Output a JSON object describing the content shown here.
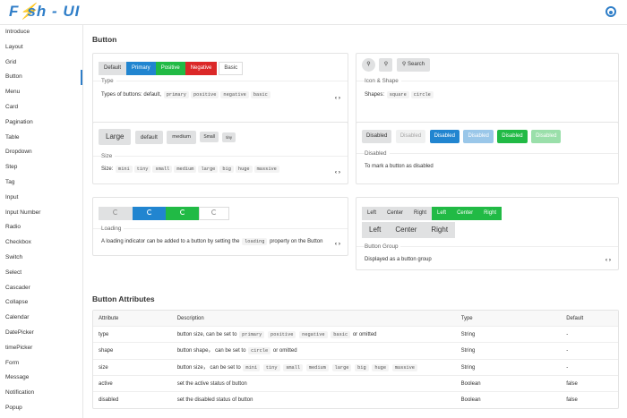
{
  "header": {
    "logo_left": "F",
    "logo_right": "sh - UI",
    "github_icon": "github-icon"
  },
  "sidebar": {
    "items": [
      "Introduce",
      "Layout",
      "Grid",
      "Button",
      "Menu",
      "Card",
      "Pagination",
      "Table",
      "Dropdown",
      "Step",
      "Tag",
      "Input",
      "Input Number",
      "Radio",
      "Checkbox",
      "Switch",
      "Select",
      "Cascader",
      "Collapse",
      "Calendar",
      "DatePicker",
      "timePicker",
      "Form",
      "Message",
      "Notification",
      "Popup"
    ],
    "active": "Button"
  },
  "page": {
    "title": "Button",
    "attr_title": "Button Attributes"
  },
  "cards": {
    "type": {
      "buttons": [
        "Default",
        "Primary",
        "Positive",
        "Negative",
        "Basic"
      ],
      "title": "Type",
      "desc_text": "Types of buttons: default,",
      "codes": [
        "primary",
        "positive",
        "negative",
        "basic"
      ]
    },
    "icon": {
      "buttons": [
        "Search"
      ],
      "title": "Icon & Shape",
      "desc_text": "Shapes:",
      "codes": [
        "square",
        "circle"
      ]
    },
    "size": {
      "buttons": [
        "Large",
        "default",
        "medium",
        "Small",
        "tiny"
      ],
      "title": "Size",
      "desc_text": "Size:",
      "codes": [
        "mini",
        "tiny",
        "small",
        "medium",
        "large",
        "big",
        "huge",
        "massive"
      ]
    },
    "disabled": {
      "buttons": [
        "Disabled",
        "Disabled",
        "Disabled",
        "Disabled",
        "Disabled",
        "Disabled"
      ],
      "title": "Disabled",
      "desc": "To mark a button as disabled"
    },
    "loading": {
      "title": "Loading",
      "desc_before": "A loading indicator can be added to a button by setting the",
      "code": "loading",
      "desc_after": "property on the Button"
    },
    "group": {
      "row1": [
        "Left",
        "Center",
        "Right",
        "Left",
        "Center",
        "Right"
      ],
      "row2": [
        "Left",
        "Center",
        "Right"
      ],
      "title": "Button Group",
      "desc": "Displayed as a button group"
    },
    "code_toggle": "‹ ›"
  },
  "table": {
    "headers": [
      "Attribute",
      "Description",
      "Type",
      "Default"
    ],
    "rows": [
      {
        "attr": "type",
        "desc_before": "button size, can be set to",
        "codes": [
          "primary",
          "positive",
          "negative",
          "basic"
        ],
        "desc_after": "or omitted",
        "type": "String",
        "default": "-"
      },
      {
        "attr": "shape",
        "desc_before": "button shape， can be set to",
        "codes": [
          "circle"
        ],
        "desc_after": "or omitted",
        "type": "String",
        "default": "-"
      },
      {
        "attr": "size",
        "desc_before": "button size， can be set to",
        "codes": [
          "mini",
          "tiny",
          "small",
          "medium",
          "large",
          "big",
          "huge",
          "massive"
        ],
        "desc_after": "",
        "type": "String",
        "default": "-"
      },
      {
        "attr": "active",
        "desc_before": "set the active status of button",
        "codes": [],
        "desc_after": "",
        "type": "Boolean",
        "default": "false"
      },
      {
        "attr": "disabled",
        "desc_before": "set the disabled status of button",
        "codes": [],
        "desc_after": "",
        "type": "Boolean",
        "default": "false"
      }
    ]
  },
  "colors": {
    "primary": "#2185d0",
    "positive": "#21ba45",
    "negative": "#db2828",
    "brand": "#2f7ec8"
  }
}
